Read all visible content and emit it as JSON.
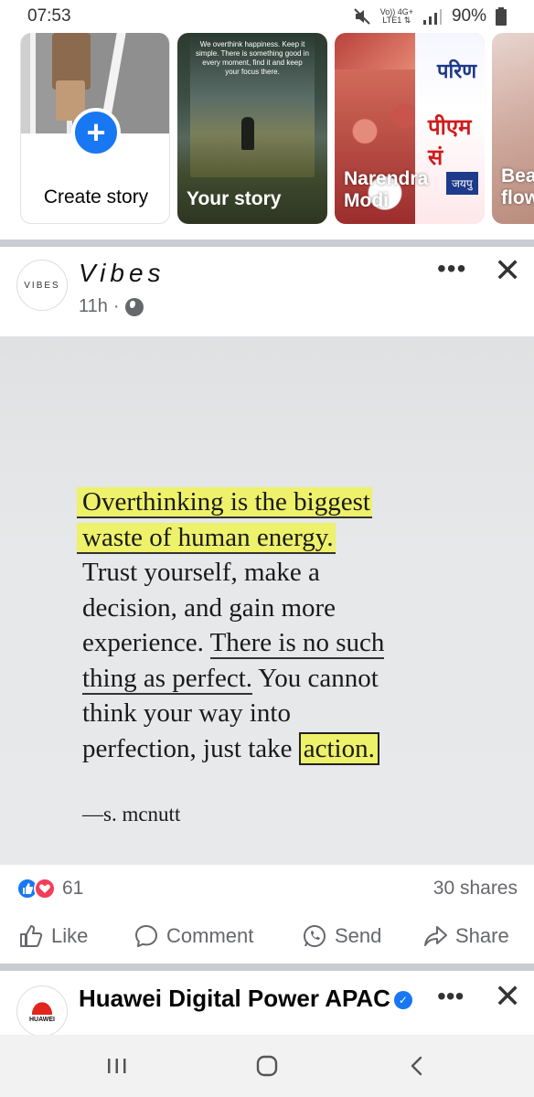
{
  "status_bar": {
    "time": "07:53",
    "network_top": "Vo)) 4G+",
    "network_bottom": "LTE1 ⇅",
    "battery": "90%"
  },
  "stories": [
    {
      "label": "Create story",
      "type": "create"
    },
    {
      "label": "Your story",
      "type": "own",
      "quote": "We overthink happiness. Keep it simple. There is something good in every moment, find it and keep your focus there."
    },
    {
      "label": "Narendra Modi",
      "type": "page",
      "banner_line1": "परिण",
      "banner_line2": "पीएम सं",
      "banner_tag": "जयपु"
    },
    {
      "label": "Bea flow",
      "type": "page"
    }
  ],
  "post": {
    "page_name": "Vibes",
    "avatar_text": "VIBES",
    "time": "11h",
    "separator": "·",
    "quote_lines": [
      "Overthinking is the biggest",
      "waste of human energy.",
      "Trust yourself, make a",
      "decision, and gain more",
      "experience. There is no such",
      "thing as perfect. You cannot",
      "think your way into",
      "perfection, just take action."
    ],
    "quote_parts": {
      "l1": "Overthinking is the biggest",
      "l2": "waste of human energy.",
      "l3": "Trust yourself, make a",
      "l4": "decision, and gain more",
      "l5a": "experience. ",
      "l5b": "There is no such",
      "l6a": "thing as perfect.",
      "l6b": " You cannot",
      "l7": "think your way into",
      "l8a": "perfection, just take ",
      "l8b": "action."
    },
    "author": "—s. mcnutt",
    "reaction_count": "61",
    "shares": "30 shares",
    "actions": {
      "like": "Like",
      "comment": "Comment",
      "send": "Send",
      "share": "Share"
    }
  },
  "next_post": {
    "page_name": "Huawei Digital Power APAC",
    "avatar_text": "HUAWEI",
    "verified_mark": "✓"
  },
  "colors": {
    "facebook_blue": "#1877f2",
    "love_red": "#f33e58",
    "highlight_yellow": "#eef16a",
    "secondary_text": "#65676b"
  }
}
